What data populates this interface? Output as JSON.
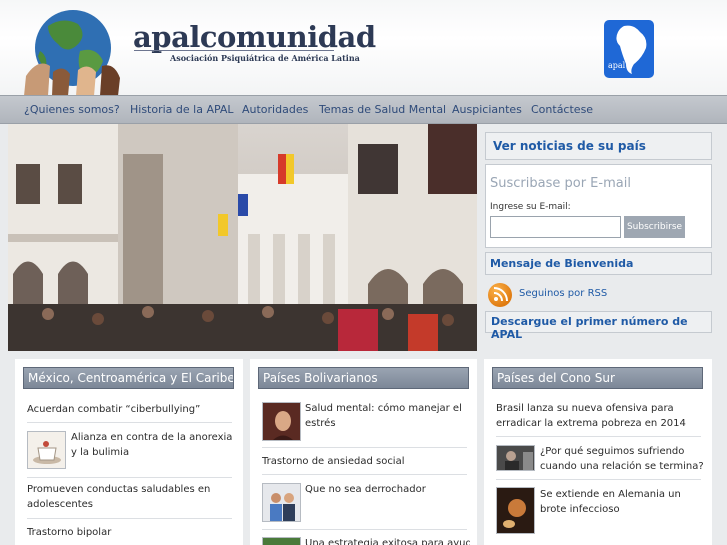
{
  "header": {
    "brand": "apalcomunidad",
    "subtitle": "Asociación Psiquiátrica de América Latina",
    "logo_text": "apal"
  },
  "nav": {
    "items": [
      "¿Quienes somos?",
      "Historia de la APAL",
      "Autoridades",
      "Temas de Salud Mental",
      "Auspiciantes",
      "Contáctese"
    ]
  },
  "sidebar": {
    "country_news": "Ver noticias de su país",
    "subscribe_title": "Suscribase por E-mail",
    "email_label": "Ingrese su E-mail:",
    "email_value": "",
    "subscribe_button": "Subscribirse",
    "welcome": "Mensaje de Bienvenida",
    "rss": "Seguinos por RSS",
    "download": "Descargue el primer número de APAL"
  },
  "columns": [
    {
      "title": "México, Centroamérica y El Caribe",
      "items": [
        "Acuerdan combatir “ciberbullying”",
        "Alianza en contra de la anorexia y la bulimia",
        "Promueven conductas saludables en adolescentes",
        "Trastorno bipolar"
      ]
    },
    {
      "title": "Países Bolivarianos",
      "items": [
        "Salud mental: cómo manejar el estrés",
        "Trastorno de ansiedad social",
        "Que no sea derrochador",
        "Una estrategia exitosa para ayudar a"
      ]
    },
    {
      "title": "Países del Cono Sur",
      "items": [
        "Brasil lanza su nueva ofensiva para erradicar la extrema pobreza en 2014",
        "¿Por qué seguimos sufriendo cuando una relación se termina?",
        "Se extiende en Alemania un brote infeccioso"
      ]
    }
  ],
  "colors": {
    "link": "#1f5aa6",
    "nav_text": "#2f4b7a",
    "column_header": "#7c8797"
  }
}
